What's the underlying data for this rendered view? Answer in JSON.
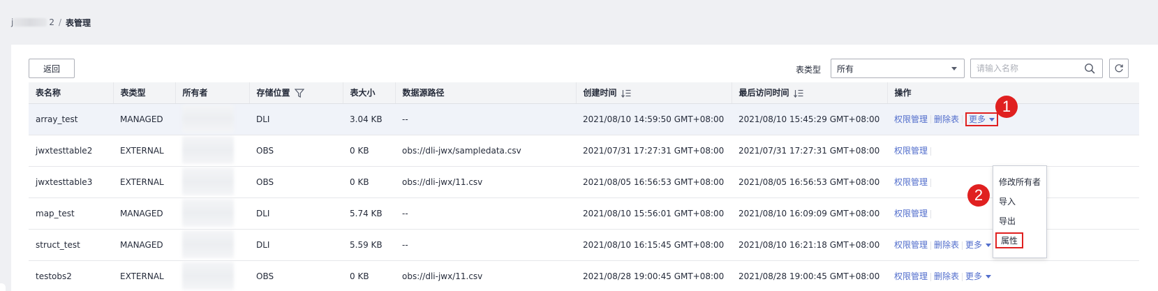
{
  "breadcrumb": {
    "prefix_visible": "j",
    "suffix_visible": "2",
    "separator": "/",
    "current": "表管理"
  },
  "toolbar": {
    "back_label": "返回",
    "table_type_label": "表类型",
    "table_type_value": "所有",
    "search_placeholder": "请输入名称"
  },
  "icons": {
    "search": "search-icon",
    "refresh": "refresh-icon",
    "filter": "filter-icon",
    "sort": "sort-icon",
    "dropdown": "chevron-down-icon"
  },
  "columns": [
    "表名称",
    "表类型",
    "所有者",
    "存储位置",
    "表大小",
    "数据源路径",
    "创建时间",
    "最后访问时间",
    "操作"
  ],
  "rows": [
    {
      "name": "array_test",
      "type": "MANAGED",
      "location": "DLI",
      "size": "3.04 KB",
      "path": "--",
      "created": "2021/08/10 14:59:50 GMT+08:00",
      "accessed": "2021/08/10 15:45:29 GMT+08:00"
    },
    {
      "name": "jwxtesttable2",
      "type": "EXTERNAL",
      "location": "OBS",
      "size": "0 KB",
      "path": "obs://dli-jwx/sampledata.csv",
      "created": "2021/07/31 17:27:31 GMT+08:00",
      "accessed": "2021/07/31 17:27:31 GMT+08:00"
    },
    {
      "name": "jwxtesttable3",
      "type": "EXTERNAL",
      "location": "OBS",
      "size": "0 KB",
      "path": "obs://dli-jwx/11.csv",
      "created": "2021/08/05 16:56:53 GMT+08:00",
      "accessed": "2021/08/05 16:56:53 GMT+08:00"
    },
    {
      "name": "map_test",
      "type": "MANAGED",
      "location": "DLI",
      "size": "5.74 KB",
      "path": "--",
      "created": "2021/08/10 15:56:01 GMT+08:00",
      "accessed": "2021/08/10 16:09:09 GMT+08:00"
    },
    {
      "name": "struct_test",
      "type": "MANAGED",
      "location": "DLI",
      "size": "5.59 KB",
      "path": "--",
      "created": "2021/08/10 16:15:45 GMT+08:00",
      "accessed": "2021/08/10 16:21:18 GMT+08:00"
    },
    {
      "name": "testobs2",
      "type": "EXTERNAL",
      "location": "OBS",
      "size": "0 KB",
      "path": "obs://dli-jwx/11.csv",
      "created": "2021/08/28 19:00:45 GMT+08:00",
      "accessed": "2021/08/28 19:00:45 GMT+08:00"
    }
  ],
  "actions": {
    "permission": "权限管理",
    "delete": "删除表",
    "more": "更多"
  },
  "more_menu": [
    "修改所有者",
    "导入",
    "导出",
    "属性"
  ],
  "callouts": [
    "1",
    "2"
  ],
  "colors": {
    "accent_link": "#526ecc",
    "callout_red": "#e02020",
    "row_highlight": "#f0f3f9",
    "header_bg": "#f3f4f6"
  }
}
